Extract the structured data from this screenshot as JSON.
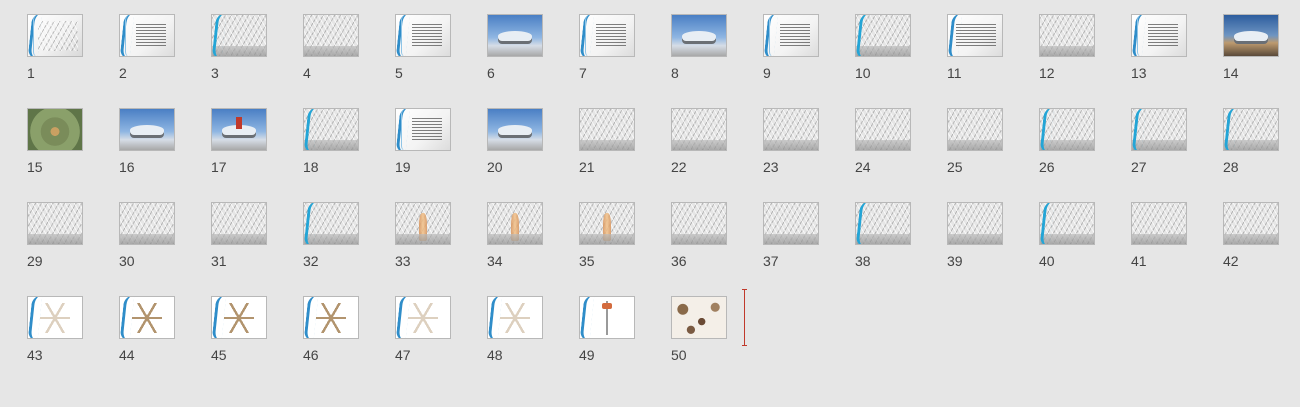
{
  "slide_sorter": {
    "slides": [
      {
        "number": "1",
        "kind": "title"
      },
      {
        "number": "2",
        "kind": "text"
      },
      {
        "number": "3",
        "kind": "arch"
      },
      {
        "number": "4",
        "kind": "hall"
      },
      {
        "number": "5",
        "kind": "text"
      },
      {
        "number": "6",
        "kind": "sky"
      },
      {
        "number": "7",
        "kind": "text"
      },
      {
        "number": "8",
        "kind": "sky"
      },
      {
        "number": "9",
        "kind": "text"
      },
      {
        "number": "10",
        "kind": "arch"
      },
      {
        "number": "11",
        "kind": "textwide"
      },
      {
        "number": "12",
        "kind": "hall"
      },
      {
        "number": "13",
        "kind": "text"
      },
      {
        "number": "14",
        "kind": "dusk"
      },
      {
        "number": "15",
        "kind": "aerial"
      },
      {
        "number": "16",
        "kind": "sky"
      },
      {
        "number": "17",
        "kind": "sky-red"
      },
      {
        "number": "18",
        "kind": "arch"
      },
      {
        "number": "19",
        "kind": "text"
      },
      {
        "number": "20",
        "kind": "sky"
      },
      {
        "number": "21",
        "kind": "hall"
      },
      {
        "number": "22",
        "kind": "hall"
      },
      {
        "number": "23",
        "kind": "hall"
      },
      {
        "number": "24",
        "kind": "hall"
      },
      {
        "number": "25",
        "kind": "hall"
      },
      {
        "number": "26",
        "kind": "arch"
      },
      {
        "number": "27",
        "kind": "arch"
      },
      {
        "number": "28",
        "kind": "arch"
      },
      {
        "number": "29",
        "kind": "hall"
      },
      {
        "number": "30",
        "kind": "hall"
      },
      {
        "number": "31",
        "kind": "hall"
      },
      {
        "number": "32",
        "kind": "arch"
      },
      {
        "number": "33",
        "kind": "column"
      },
      {
        "number": "34",
        "kind": "column"
      },
      {
        "number": "35",
        "kind": "column"
      },
      {
        "number": "36",
        "kind": "hall"
      },
      {
        "number": "37",
        "kind": "hall"
      },
      {
        "number": "38",
        "kind": "arch"
      },
      {
        "number": "39",
        "kind": "hall"
      },
      {
        "number": "40",
        "kind": "arch"
      },
      {
        "number": "41",
        "kind": "hall"
      },
      {
        "number": "42",
        "kind": "hall"
      },
      {
        "number": "43",
        "kind": "plan-light"
      },
      {
        "number": "44",
        "kind": "plan"
      },
      {
        "number": "45",
        "kind": "plan"
      },
      {
        "number": "46",
        "kind": "plan"
      },
      {
        "number": "47",
        "kind": "plan-light"
      },
      {
        "number": "48",
        "kind": "plan-light"
      },
      {
        "number": "49",
        "kind": "post"
      },
      {
        "number": "50",
        "kind": "collage"
      }
    ]
  },
  "colors": {
    "background": "#e6e6e6",
    "accent_blue": "#2f8dc9",
    "insertion_marker": "#c0392b"
  }
}
